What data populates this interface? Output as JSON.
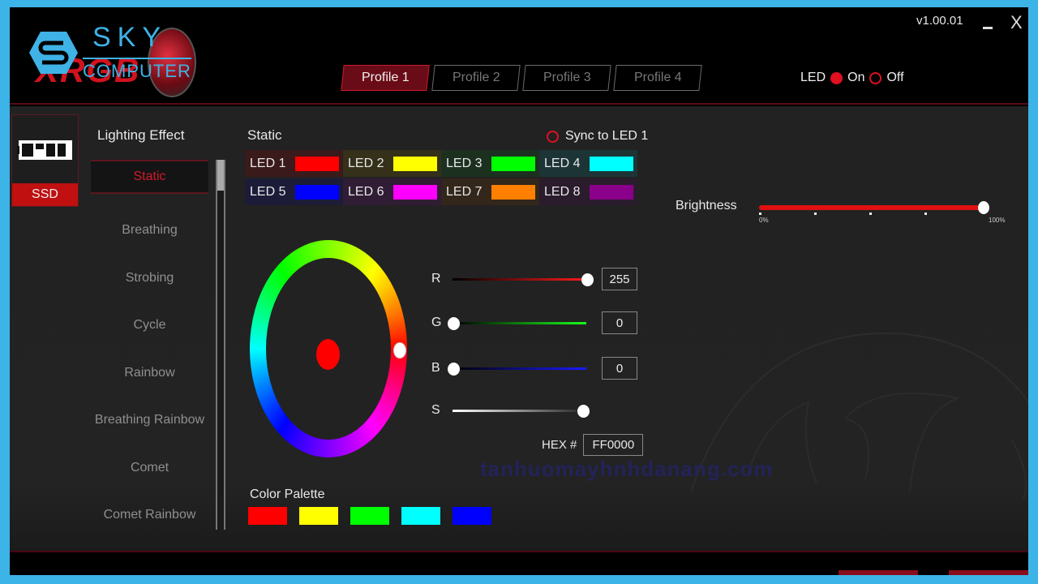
{
  "header": {
    "brand": {
      "top": "SKY",
      "bottom": "COMPUTER",
      "product": "XRGB"
    },
    "version": "v1.00.01",
    "window_controls": {
      "minimize_icon": "minimize-icon",
      "close_label": "X"
    },
    "profiles": [
      {
        "label": "Profile 1",
        "active": true
      },
      {
        "label": "Profile 2",
        "active": false
      },
      {
        "label": "Profile 3",
        "active": false
      },
      {
        "label": "Profile 4",
        "active": false
      }
    ],
    "led_toggle": {
      "label": "LED",
      "on_label": "On",
      "off_label": "Off",
      "selected": "On"
    }
  },
  "device": {
    "label": "SSD",
    "icon": "ssd-icon"
  },
  "effects": {
    "title": "Lighting Effect",
    "items": [
      "Static",
      "Breathing",
      "Strobing",
      "Cycle",
      "Rainbow",
      "Breathing Rainbow",
      "Comet",
      "Comet Rainbow"
    ],
    "selected": "Static"
  },
  "static": {
    "title": "Static",
    "sync_label": "Sync to LED 1",
    "sync_checked": false,
    "leds": [
      {
        "label": "LED 1",
        "color": "#ff0000",
        "bg": "#3a1a1a"
      },
      {
        "label": "LED 2",
        "color": "#ffff00",
        "bg": "#34301a"
      },
      {
        "label": "LED 3",
        "color": "#00ff00",
        "bg": "#1c3020"
      },
      {
        "label": "LED 4",
        "color": "#00ffff",
        "bg": "#1c3436"
      },
      {
        "label": "LED 5",
        "color": "#0000ff",
        "bg": "#1c1c38"
      },
      {
        "label": "LED 6",
        "color": "#ff00ff",
        "bg": "#301c34"
      },
      {
        "label": "LED 7",
        "color": "#ff8000",
        "bg": "#33261a"
      },
      {
        "label": "LED 8",
        "color": "#8b008b",
        "bg": "#2a1c2c"
      }
    ]
  },
  "color_picker": {
    "selected_color": "#ff0000",
    "r": {
      "label": "R",
      "value": "255",
      "fraction": 1.0
    },
    "g": {
      "label": "G",
      "value": "0",
      "fraction": 0.0
    },
    "b": {
      "label": "B",
      "value": "0",
      "fraction": 0.0
    },
    "s": {
      "label": "S",
      "fraction": 0.97
    },
    "hex_label": "HEX #",
    "hex_value": "FF0000"
  },
  "palette": {
    "title": "Color Palette",
    "colors": [
      "#ff0000",
      "#ffff00",
      "#00ff00",
      "#00ffff",
      "#0000ff"
    ]
  },
  "brightness": {
    "label": "Brightness",
    "min_label": "0%",
    "max_label": "100%",
    "value_percent": 100
  },
  "watermark": {
    "text": "tanhuomayhnhdanang.com"
  }
}
